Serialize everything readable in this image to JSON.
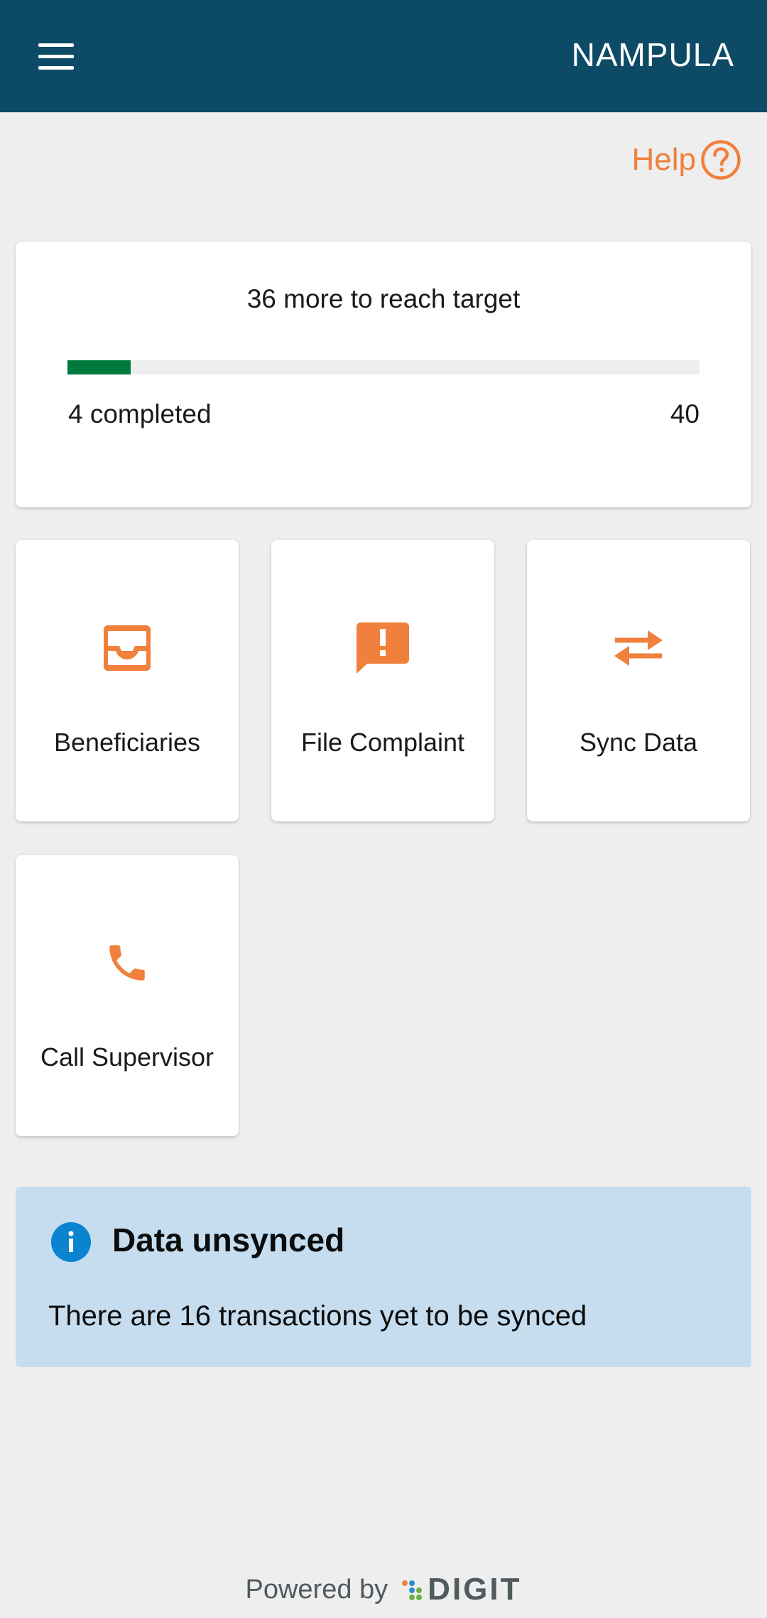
{
  "app_bar": {
    "title": "NAMPULA",
    "menu_icon": "hamburger-menu-icon",
    "background_color": "#0c4a66"
  },
  "help": {
    "label": "Help",
    "icon": "help-circle-icon",
    "color": "#f0803c"
  },
  "progress": {
    "title": "36 more to reach target",
    "completed_label": "4 completed",
    "target_label": "40",
    "completed": 4,
    "target": 40,
    "fill_color": "#007a3d"
  },
  "tiles": [
    {
      "label": "Beneficiaries",
      "icon": "inbox-tray-icon"
    },
    {
      "label": "File Complaint",
      "icon": "feedback-exclamation-icon"
    },
    {
      "label": "Sync Data",
      "icon": "sync-arrows-icon"
    },
    {
      "label": "Call Supervisor",
      "icon": "phone-icon"
    }
  ],
  "accent_color": "#f0803c",
  "info_banner": {
    "title": "Data unsynced",
    "message": "There are 16 transactions yet to be synced",
    "icon": "info-icon",
    "background_color": "#c6ddef",
    "icon_color": "#0b84d0"
  },
  "footer": {
    "text": "Powered by",
    "logo_text": "DIGIT"
  }
}
